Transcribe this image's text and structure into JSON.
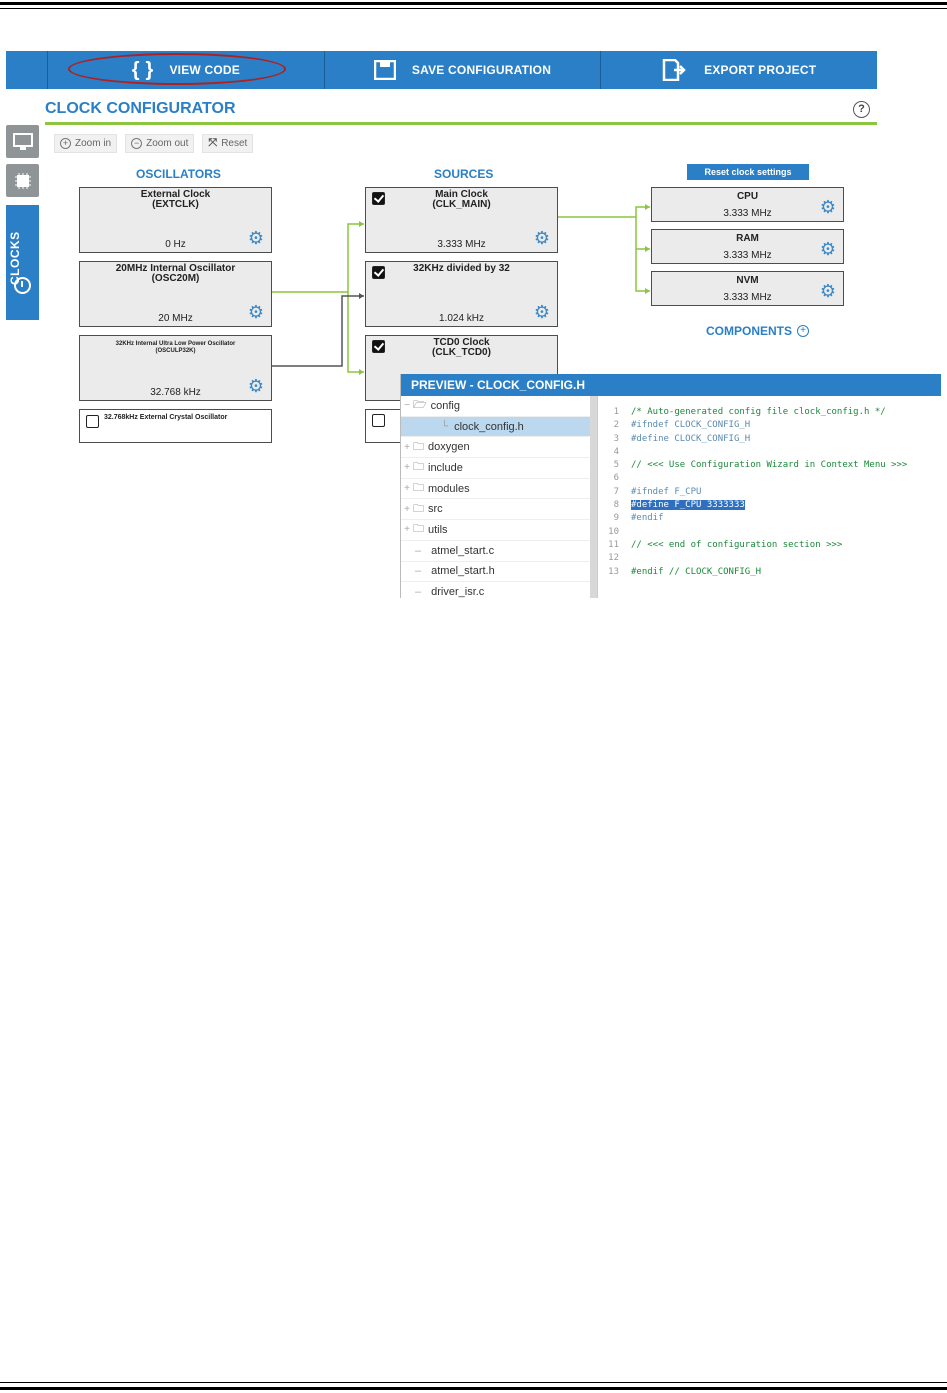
{
  "toolbar": {
    "view_code": "VIEW CODE",
    "save_configuration": "SAVE CONFIGURATION",
    "export_project": "EXPORT PROJECT"
  },
  "sidebar": {
    "clocks_label": "CLOCKS"
  },
  "page_title": "CLOCK CONFIGURATOR",
  "help_label": "?",
  "zoom": {
    "zoom_in": "Zoom in",
    "zoom_out": "Zoom out",
    "reset": "Reset"
  },
  "oscillators": {
    "heading": "OSCILLATORS",
    "items": [
      {
        "title": "External Clock\n(EXTCLK)",
        "value": "0 Hz"
      },
      {
        "title": "20MHz Internal Oscillator\n(OSC20M)",
        "value": "20 MHz"
      },
      {
        "title": "32KHz Internal Ultra Low Power Oscillator\n(OSCULP32K)",
        "value": "32.768 kHz"
      }
    ],
    "crystal_label": "32.768kHz External Crystal Oscillator",
    "crystal_checked": false
  },
  "sources": {
    "heading": "SOURCES",
    "items": [
      {
        "title": "Main Clock\n(CLK_MAIN)",
        "value": "3.333 MHz",
        "checked": true
      },
      {
        "title": "32KHz divided by 32",
        "value": "1.024 kHz",
        "checked": true
      },
      {
        "title": "TCD0 Clock\n(CLK_TCD0)",
        "value": "",
        "checked": true
      }
    ]
  },
  "outputs": {
    "reset_label": "Reset clock settings",
    "items": [
      {
        "title": "CPU",
        "value": "3.333 MHz"
      },
      {
        "title": "RAM",
        "value": "3.333 MHz"
      },
      {
        "title": "NVM",
        "value": "3.333 MHz"
      }
    ],
    "components_label": "COMPONENTS"
  },
  "preview": {
    "title": "PREVIEW - CLOCK_CONFIG.H",
    "tree": [
      {
        "label": "config",
        "type": "folder-open",
        "expand": "−"
      },
      {
        "label": "clock_config.h",
        "type": "file",
        "selected": true
      },
      {
        "label": "doxygen",
        "type": "folder",
        "expand": "+"
      },
      {
        "label": "include",
        "type": "folder",
        "expand": "+"
      },
      {
        "label": "modules",
        "type": "folder",
        "expand": "+"
      },
      {
        "label": "src",
        "type": "folder",
        "expand": "+"
      },
      {
        "label": "utils",
        "type": "folder",
        "expand": "+"
      },
      {
        "label": "atmel_start.c",
        "type": "file"
      },
      {
        "label": "atmel_start.h",
        "type": "file"
      },
      {
        "label": "driver_isr.c",
        "type": "file"
      }
    ],
    "line_numbers": [
      "1",
      "2",
      "3",
      "4",
      "5",
      "6",
      "7",
      "8",
      "9",
      "10",
      "11",
      "12",
      "13"
    ],
    "code": [
      "/* Auto-generated config file clock_config.h */",
      "#ifndef CLOCK_CONFIG_H",
      "#define CLOCK_CONFIG_H",
      "",
      "// <<< Use Configuration Wizard in Context Menu >>>",
      "",
      "#ifndef F_CPU",
      "#define F_CPU 3333333",
      "#endif",
      "",
      "// <<< end of configuration section >>>",
      "",
      "#endif // CLOCK_CONFIG_H"
    ]
  },
  "colors": {
    "accent": "#2a7fc6",
    "green": "#8cc63f",
    "highlight_oval": "#b02020"
  }
}
